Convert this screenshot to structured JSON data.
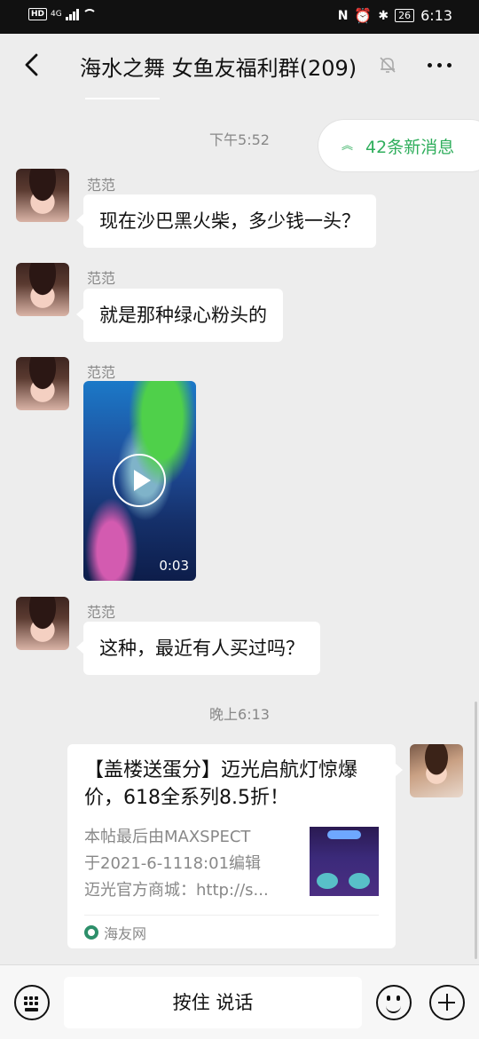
{
  "status_bar": {
    "hd": "HD",
    "network": "4G",
    "battery": "26",
    "time": "6:13"
  },
  "header": {
    "title": "海水之舞 女鱼友福利群(209)"
  },
  "new_messages": {
    "label": "42条新消息"
  },
  "messages": [
    {
      "type": "time",
      "text": "下午5:52"
    },
    {
      "type": "text",
      "sender": "范范",
      "text": "现在沙巴黑火柴，多少钱一头？"
    },
    {
      "type": "text",
      "sender": "范范",
      "text": "就是那种绿心粉头的"
    },
    {
      "type": "video",
      "sender": "范范",
      "duration": "0:03"
    },
    {
      "type": "text",
      "sender": "范范",
      "text": "这种，最近有人买过吗？"
    },
    {
      "type": "time",
      "text": "晚上6:13"
    },
    {
      "type": "link_card",
      "title": "【盖楼送蛋分】迈光启航灯惊爆价，618全系列8.5折！",
      "desc_lines": [
        "本帖最后由MAXSPECT",
        "于2021-6-1118:01编辑",
        "迈光官方商城：http://s..."
      ],
      "source": "海友网"
    }
  ],
  "input_bar": {
    "hold_to_talk": "按住 说话"
  },
  "colors": {
    "accent_green": "#2fae5c",
    "chat_background": "#ededed"
  }
}
